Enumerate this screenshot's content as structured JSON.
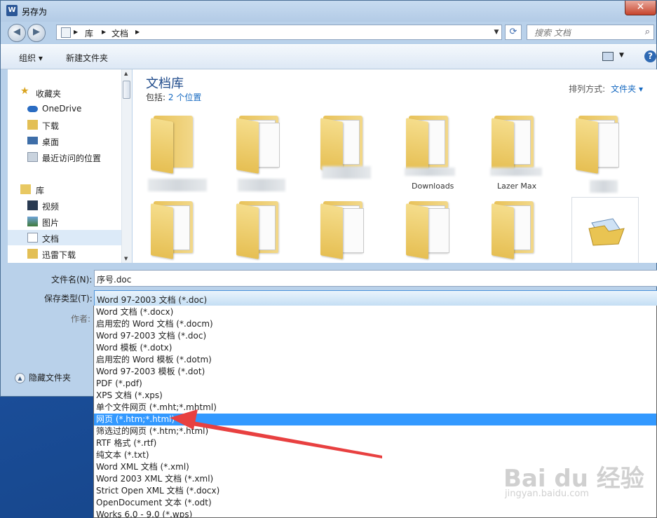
{
  "window": {
    "title": "另存为",
    "app_icon": "W"
  },
  "address": {
    "segments": [
      "库",
      "文档"
    ],
    "search_placeholder": "搜索 文档"
  },
  "toolbar": {
    "organize": "组织 ▾",
    "new_folder": "新建文件夹"
  },
  "sidebar": {
    "items": [
      {
        "label": "收藏夹",
        "icon": "star-icon"
      },
      {
        "label": "OneDrive",
        "icon": "cloud-icon"
      },
      {
        "label": "下载",
        "icon": "download-folder-icon"
      },
      {
        "label": "桌面",
        "icon": "desktop-icon"
      },
      {
        "label": "最近访问的位置",
        "icon": "recent-places-icon"
      },
      {
        "label": "库",
        "icon": "library-icon"
      },
      {
        "label": "视频",
        "icon": "video-icon"
      },
      {
        "label": "图片",
        "icon": "pictures-icon"
      },
      {
        "label": "文档",
        "icon": "documents-icon"
      },
      {
        "label": "迅雷下载",
        "icon": "thunder-download-icon"
      }
    ]
  },
  "library": {
    "title": "文档库",
    "includes_prefix": "包括:",
    "includes_link": "2 个位置",
    "sort_label": "排列方式:",
    "sort_value": "文件夹 ▾",
    "folder_labels": {
      "f3": "Downloads",
      "f4": "Lazer Max"
    }
  },
  "form": {
    "filename_label": "文件名(N):",
    "filename_value": "序号.doc",
    "filetype_label": "保存类型(T):",
    "filetype_value": "Word 97-2003 文档 (*.doc)",
    "author_label": "作者:",
    "hide_folders": "隐藏文件夹"
  },
  "filetype_options": [
    "Word 文档 (*.docx)",
    "启用宏的 Word 文档 (*.docm)",
    "Word 97-2003 文档 (*.doc)",
    "Word 模板 (*.dotx)",
    "启用宏的 Word 模板 (*.dotm)",
    "Word 97-2003 模板 (*.dot)",
    "PDF (*.pdf)",
    "XPS 文档 (*.xps)",
    "单个文件网页 (*.mht;*.mhtml)",
    "网页 (*.htm;*.html)",
    "筛选过的网页 (*.htm;*.html)",
    "RTF 格式 (*.rtf)",
    "纯文本 (*.txt)",
    "Word XML 文档 (*.xml)",
    "Word 2003 XML 文档 (*.xml)",
    "Strict Open XML 文档 (*.docx)",
    "OpenDocument 文本 (*.odt)",
    "Works 6.0 - 9.0 (*.wps)"
  ],
  "selected_option_index": 9,
  "watermark": {
    "main": "Bai du 经验",
    "sub": "jingyan.baidu.com"
  },
  "colors": {
    "selection": "#3399ff",
    "annotation_arrow": "#e84040"
  }
}
